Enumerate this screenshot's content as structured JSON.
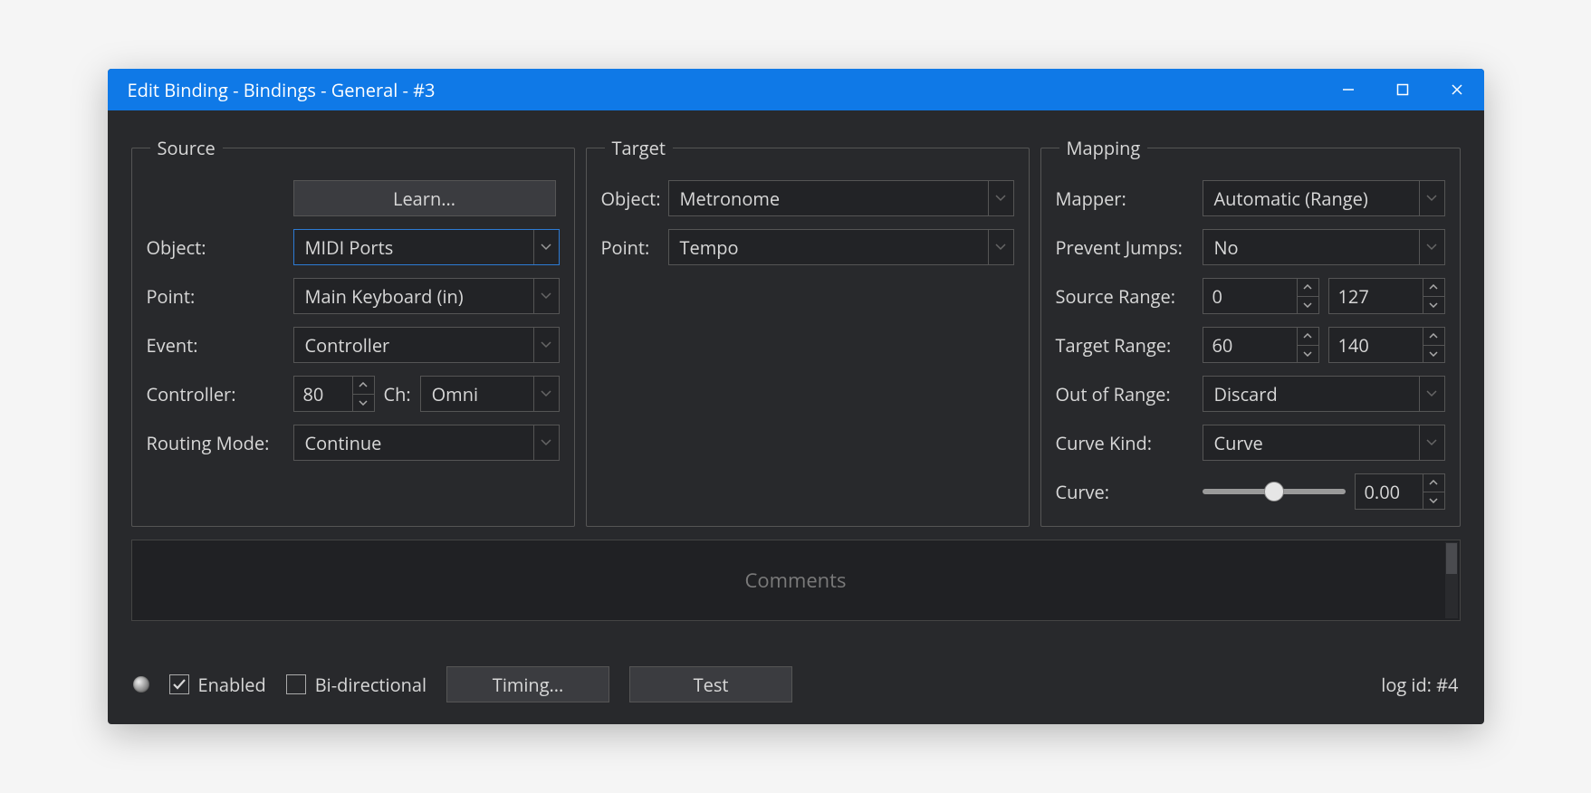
{
  "window": {
    "title": "Edit Binding - Bindings - General - #3"
  },
  "source": {
    "legend": "Source",
    "learn_label": "Learn...",
    "object_label": "Object:",
    "object_value": "MIDI Ports",
    "point_label": "Point:",
    "point_value": "Main Keyboard (in)",
    "event_label": "Event:",
    "event_value": "Controller",
    "controller_label": "Controller:",
    "controller_value": "80",
    "ch_label": "Ch:",
    "ch_value": "Omni",
    "routing_label": "Routing Mode:",
    "routing_value": "Continue"
  },
  "target": {
    "legend": "Target",
    "object_label": "Object:",
    "object_value": "Metronome",
    "point_label": "Point:",
    "point_value": "Tempo"
  },
  "mapping": {
    "legend": "Mapping",
    "mapper_label": "Mapper:",
    "mapper_value": "Automatic (Range)",
    "prevent_label": "Prevent Jumps:",
    "prevent_value": "No",
    "srcrange_label": "Source Range:",
    "srcrange_min": "0",
    "srcrange_max": "127",
    "tgtrange_label": "Target Range:",
    "tgtrange_min": "60",
    "tgtrange_max": "140",
    "oor_label": "Out of Range:",
    "oor_value": "Discard",
    "curvekind_label": "Curve Kind:",
    "curvekind_value": "Curve",
    "curve_label": "Curve:",
    "curve_value": "0.00"
  },
  "comments": {
    "placeholder": "Comments"
  },
  "footer": {
    "enabled_label": "Enabled",
    "bidir_label": "Bi-directional",
    "timing_label": "Timing...",
    "test_label": "Test",
    "logid": "log id: #4"
  }
}
